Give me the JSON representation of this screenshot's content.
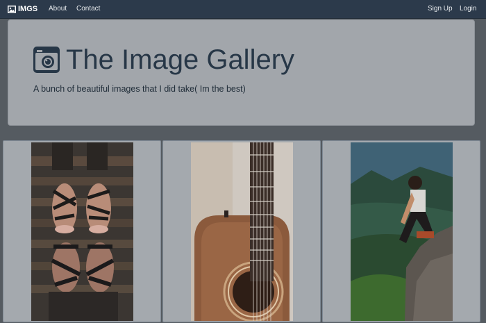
{
  "navbar": {
    "brand": "IMGS",
    "links": [
      "About",
      "Contact"
    ],
    "right_links": [
      "Sign Up",
      "Login"
    ]
  },
  "hero": {
    "title": "The Image Gallery",
    "subtitle": "A bunch of beautiful images that I did take( Im the best)",
    "icon": "camera-icon"
  },
  "gallery": {
    "images": [
      {
        "name": "feet-sandals-photo"
      },
      {
        "name": "acoustic-guitar-photo"
      },
      {
        "name": "man-on-cliff-photo"
      }
    ]
  },
  "colors": {
    "navbar_bg": "#2c3a4b",
    "page_bg": "#555b61",
    "jumbotron_bg": "#a2a6ab",
    "title_color": "#273747"
  }
}
